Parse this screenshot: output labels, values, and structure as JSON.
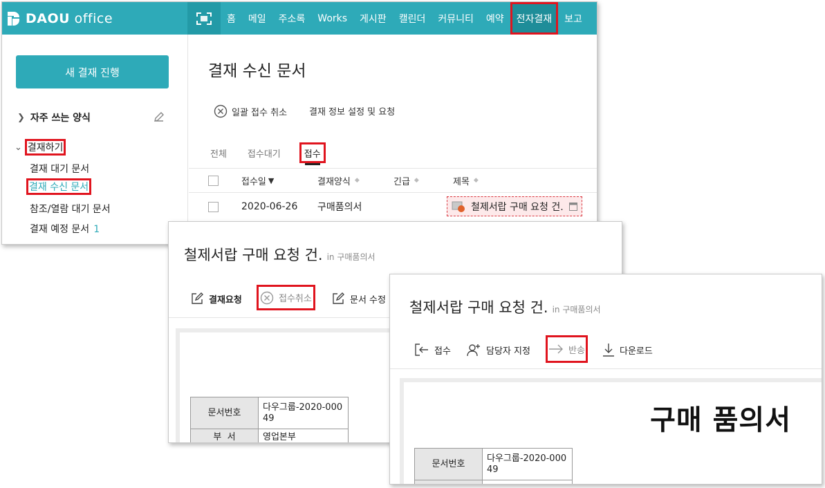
{
  "topbar": {
    "logo_brand": "DAOU",
    "logo_product": "office",
    "nav_items": [
      "홈",
      "메일",
      "주소록",
      "Works",
      "게시판",
      "캘린더",
      "커뮤니티",
      "예약",
      "전자결재",
      "보고"
    ]
  },
  "sidebar": {
    "new_button": "새 결재 진행",
    "frequent_forms": "자주 쓰는 양식",
    "approval_section": "결재하기",
    "items": [
      {
        "label": "결재 대기 문서",
        "count": ""
      },
      {
        "label": "결재 수신 문서",
        "count": ""
      },
      {
        "label": "참조/열람 대기 문서",
        "count": ""
      },
      {
        "label": "결재 예정 문서",
        "count": "1"
      }
    ]
  },
  "main": {
    "title": "결재 수신 문서",
    "toolbar": {
      "cancel_all": "일괄 접수 취소",
      "settings": "결재 정보 설정 및 요청"
    },
    "tabs": [
      "전체",
      "접수대기",
      "접수"
    ],
    "columns": [
      "접수일",
      "결재양식",
      "긴급",
      "제목"
    ],
    "rows": [
      {
        "date": "2020-06-26",
        "form": "구매품의서",
        "urgent": "",
        "subject": "철제서랍 구매 요청 건."
      }
    ]
  },
  "doc_panel_1": {
    "title": "철제서랍 구매 요청 건.",
    "form_tag": "in 구매품의서",
    "tools": {
      "request": "결재요청",
      "cancel_receipt": "접수취소",
      "edit": "문서 수정"
    },
    "table": [
      {
        "label": "문서번호",
        "value": "다우그룹-2020-000\n49"
      },
      {
        "label": "부  서",
        "value": "영업본부"
      }
    ]
  },
  "doc_panel_2": {
    "title": "철제서랍 구매 요청 건.",
    "form_tag": "in 구매품의서",
    "tools": {
      "receive": "접수",
      "assign": "담당자 지정",
      "return": "반송",
      "download": "다운로드"
    },
    "heading": "구매 품의서",
    "table": [
      {
        "label": "문서번호",
        "value": "다우그룹-2020-000\n49"
      }
    ]
  },
  "colors": {
    "accent": "#2eaab8",
    "highlight": "#e0141e",
    "active_nav": "#1e8d99"
  }
}
